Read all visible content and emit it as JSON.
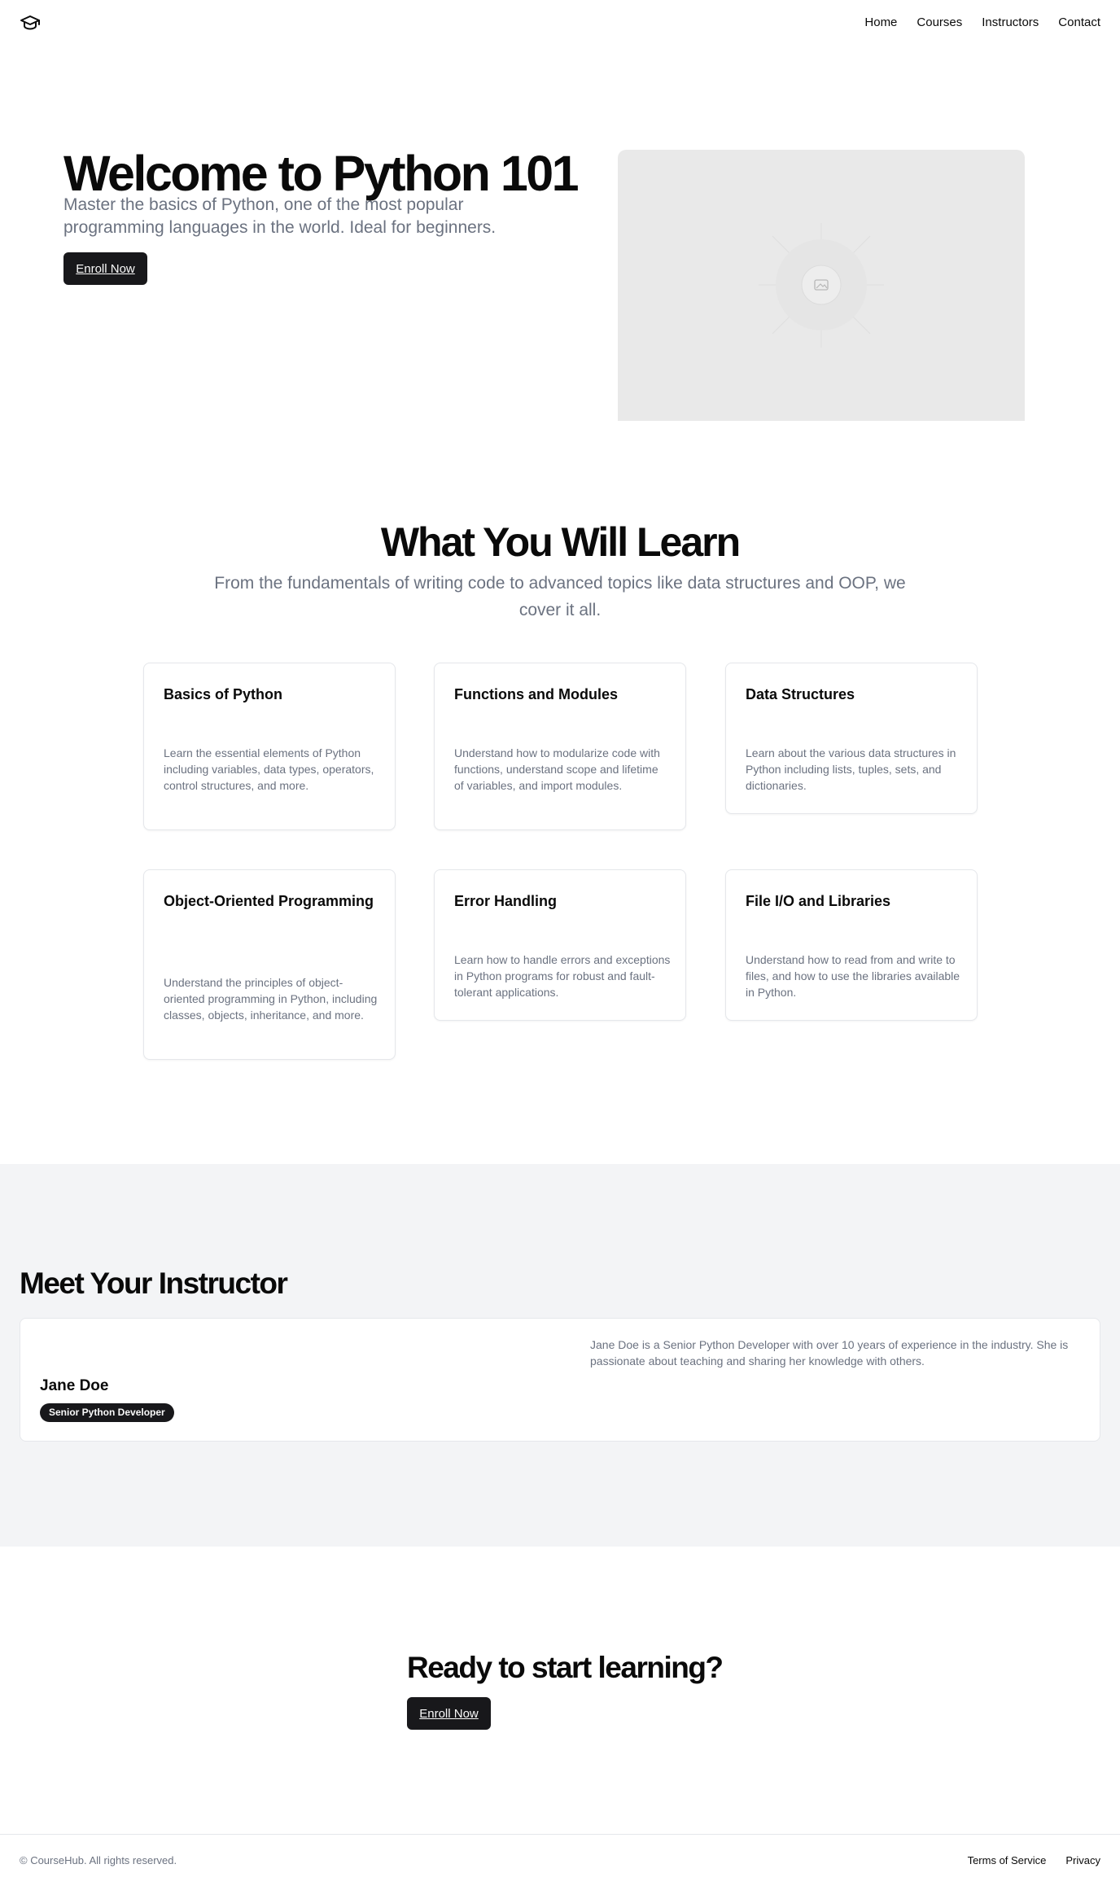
{
  "header": {
    "logo_icon": "graduation-cap-icon",
    "nav": [
      "Home",
      "Courses",
      "Instructors",
      "Contact"
    ]
  },
  "hero": {
    "title": "Welcome to Python 101",
    "subtitle": "Master the basics of Python, one of the most popular programming languages in the world. Ideal for beginners.",
    "cta_label": "Enroll Now",
    "image_icon": "image-placeholder-icon"
  },
  "learn": {
    "title": "What You Will Learn",
    "subtitle": "From the fundamentals of writing code to advanced topics like data structures and OOP, we cover it all.",
    "cards": [
      {
        "title": "Basics of Python",
        "desc": "Learn the essential elements of Python including variables, data types, operators, control structures, and more."
      },
      {
        "title": "Functions and Modules",
        "desc": "Understand how to modularize code with functions, understand scope and lifetime of variables, and import modules."
      },
      {
        "title": "Data Structures",
        "desc": "Learn about the various data structures in Python including lists, tuples, sets, and dictionaries."
      },
      {
        "title": "Object-Oriented Programming",
        "desc": "Understand the principles of object-oriented programming in Python, including classes, objects, inheritance, and more."
      },
      {
        "title": "Error Handling",
        "desc": "Learn how to handle errors and exceptions in Python programs for robust and fault-tolerant applications."
      },
      {
        "title": "File I/O and Libraries",
        "desc": "Understand how to read from and write to files, and how to use the libraries available in Python."
      }
    ]
  },
  "instructor": {
    "section_title": "Meet Your Instructor",
    "name": "Jane Doe",
    "role": "Senior Python Developer",
    "bio": "Jane Doe is a Senior Python Developer with over 10 years of experience in the industry. She is passionate about teaching and sharing her knowledge with others."
  },
  "cta": {
    "title": "Ready to start learning?",
    "button_label": "Enroll Now"
  },
  "footer": {
    "copyright": "© CourseHub. All rights reserved.",
    "links": [
      "Terms of Service",
      "Privacy"
    ]
  },
  "colors": {
    "primary": "#18181b",
    "muted_text": "#6b7280",
    "section_bg": "#f3f4f6",
    "border": "#e5e7eb"
  }
}
